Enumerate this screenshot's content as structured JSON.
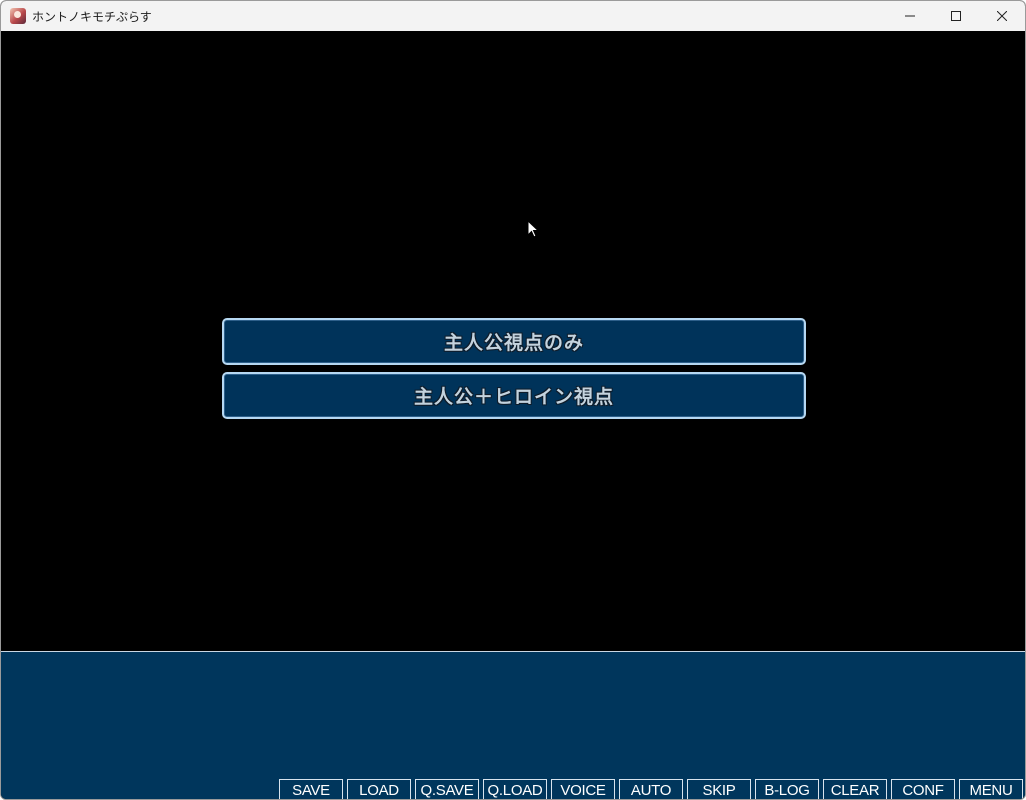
{
  "window": {
    "title": "ホントノキモチぷらす"
  },
  "choices": [
    {
      "label": "主人公視点のみ"
    },
    {
      "label": "主人公＋ヒロイン視点"
    }
  ],
  "toolbar": {
    "buttons": [
      {
        "label": "SAVE"
      },
      {
        "label": "LOAD"
      },
      {
        "label": "Q.SAVE"
      },
      {
        "label": "Q.LOAD"
      },
      {
        "label": "VOICE"
      },
      {
        "label": "AUTO"
      },
      {
        "label": "SKIP"
      },
      {
        "label": "B-LOG"
      },
      {
        "label": "CLEAR"
      },
      {
        "label": "CONF"
      },
      {
        "label": "MENU"
      }
    ]
  },
  "colors": {
    "choice_background": "#00335a",
    "choice_border": "#b6d8f2",
    "message_box": "#00365c",
    "game_background": "#000000"
  }
}
